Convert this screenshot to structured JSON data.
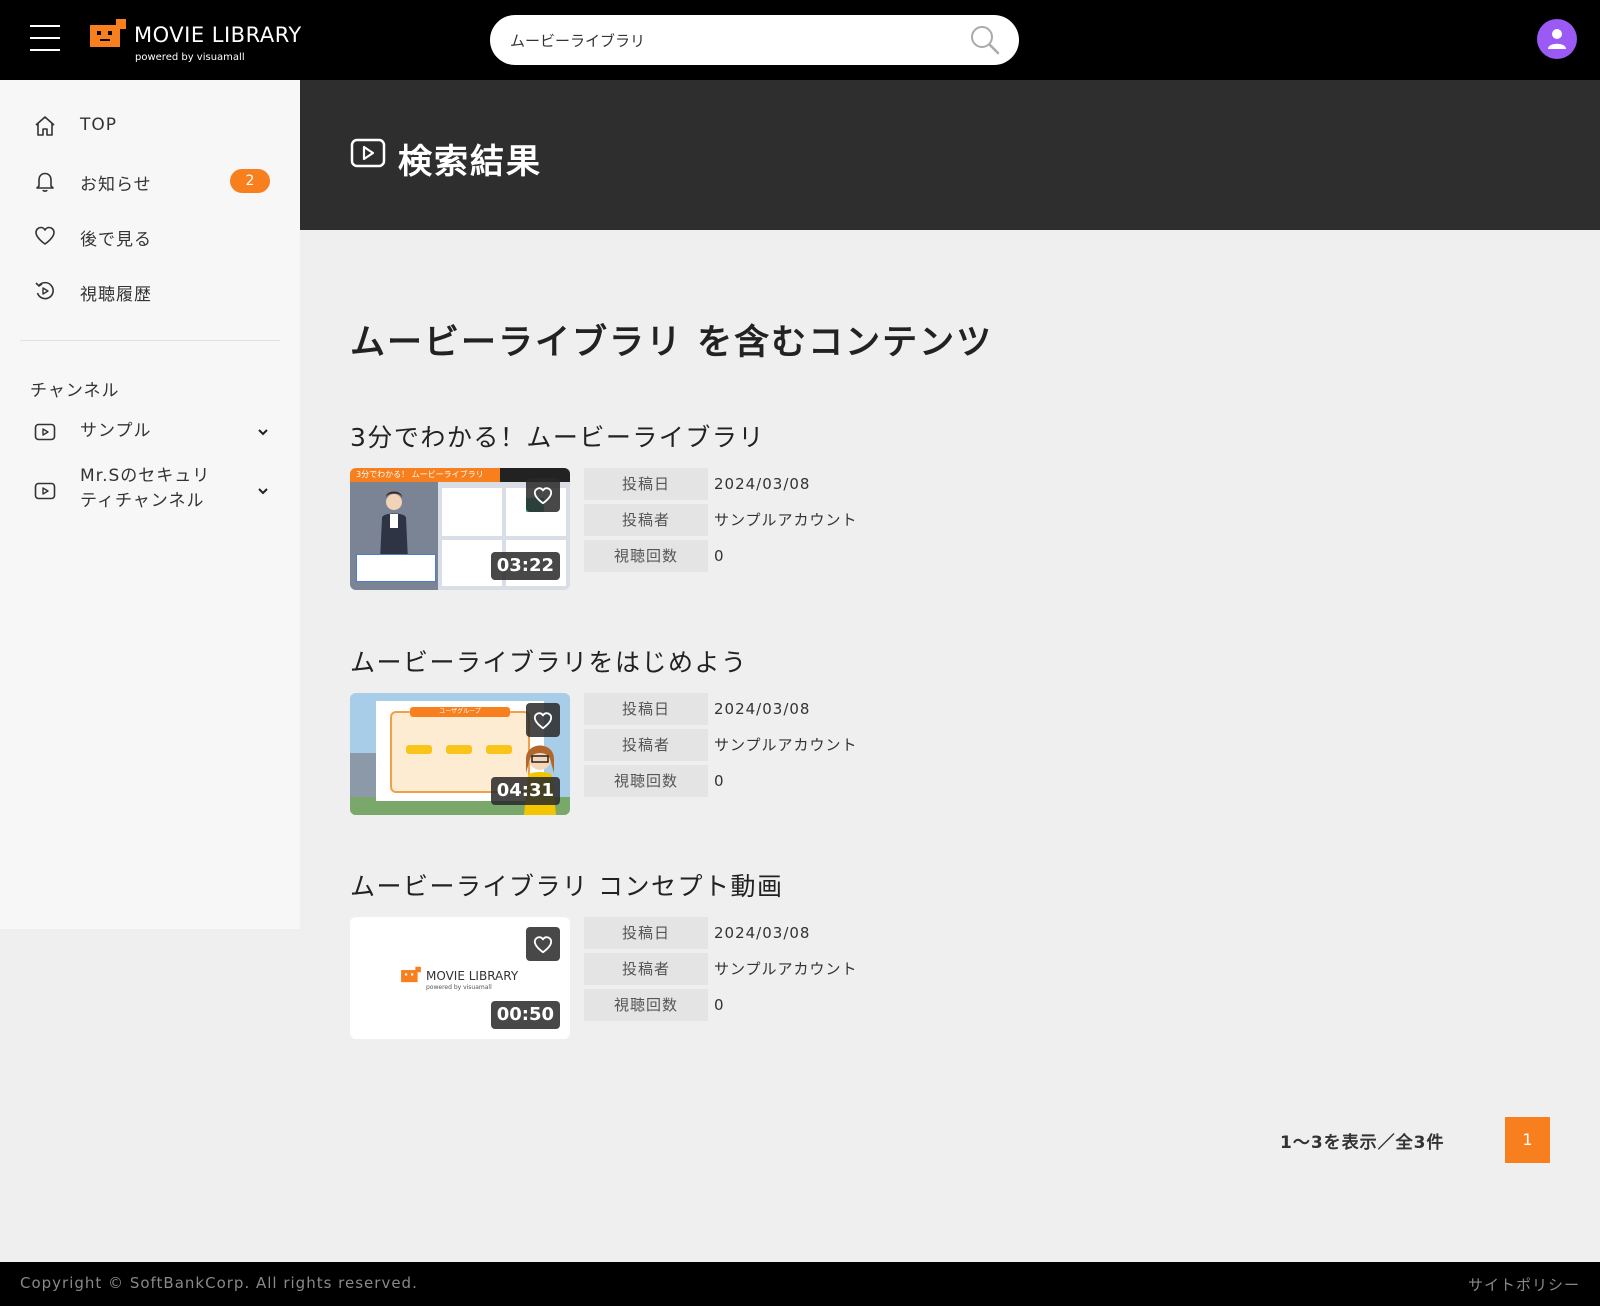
{
  "header": {
    "logo_text": "MOVIE LIBRARY",
    "logo_sub": "powered by visuamall",
    "search_value": "ムービーライブラリ",
    "brand_color": "#f77f1e",
    "avatar_color": "#9b59f5"
  },
  "sidebar": {
    "items": [
      {
        "label": "TOP",
        "icon": "home-icon"
      },
      {
        "label": "お知らせ",
        "icon": "bell-icon",
        "badge": "2"
      },
      {
        "label": "後で見る",
        "icon": "heart-icon"
      },
      {
        "label": "視聴履歴",
        "icon": "history-icon"
      }
    ],
    "channel_heading": "チャンネル",
    "channels": [
      {
        "label": "サンプル",
        "icon": "play-icon"
      },
      {
        "label_line1": "Mr.Sのセキュリ",
        "label_line2": "ティチャンネル",
        "icon": "play-icon"
      }
    ]
  },
  "banner": {
    "title": "検索結果"
  },
  "results": {
    "heading": "ムービーライブラリ を含むコンテンツ",
    "meta_keys": {
      "date": "投稿日",
      "author": "投稿者",
      "views": "視聴回数"
    },
    "videos": [
      {
        "title": "3分でわかる！ムービーライブラリ",
        "duration": "03:22",
        "date": "2024/03/08",
        "author": "サンプルアカウント",
        "views": "0",
        "thumb_caption": "3分でわかる！ ムービーライブラリ"
      },
      {
        "title": "ムービーライブラリをはじめよう",
        "duration": "04:31",
        "date": "2024/03/08",
        "author": "サンプルアカウント",
        "views": "0",
        "thumb_caption": "ユーザグループ"
      },
      {
        "title": "ムービーライブラリ コンセプト動画",
        "duration": "00:50",
        "date": "2024/03/08",
        "author": "サンプルアカウント",
        "views": "0",
        "thumb_caption": "MOVIE LIBRARY",
        "thumb_sub": "powered by visuamall"
      }
    ]
  },
  "pagination": {
    "info": "1〜3を表示／全3件",
    "current_page": "1"
  },
  "footer": {
    "copyright": "Copyright © SoftBankCorp. All rights reserved.",
    "policy": "サイトポリシー"
  }
}
